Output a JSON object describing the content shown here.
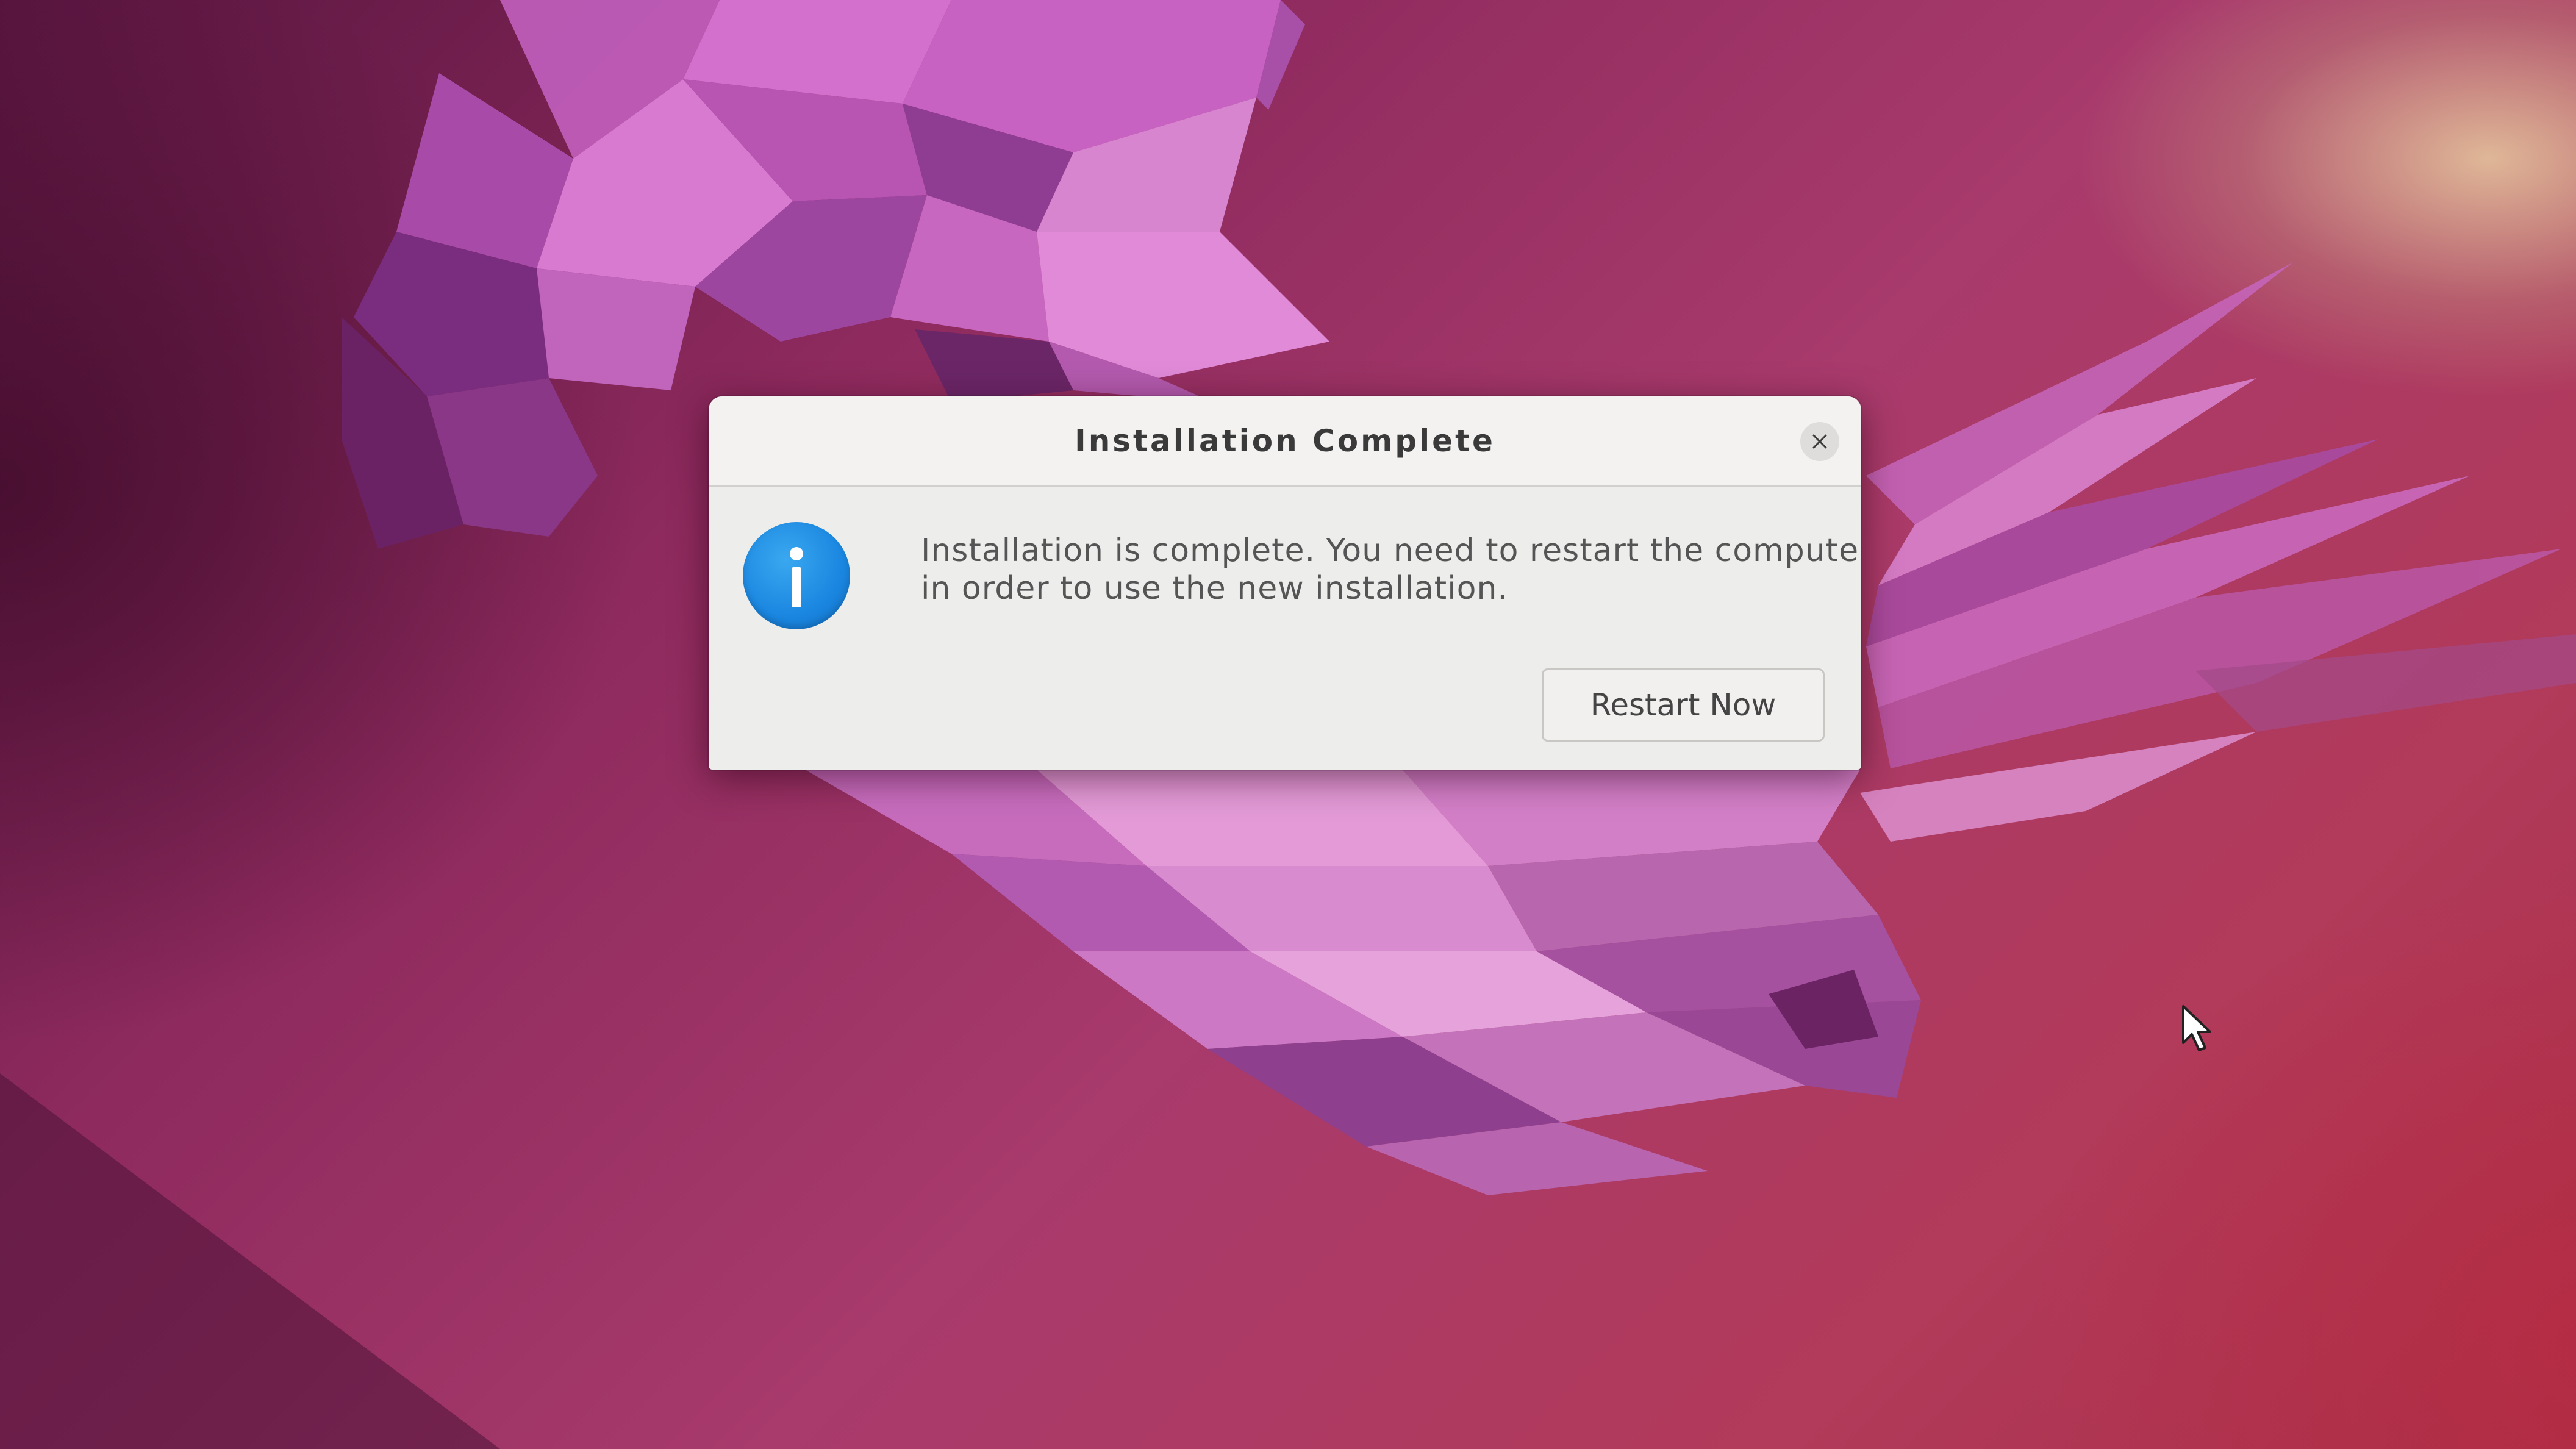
{
  "dialog": {
    "title": "Installation Complete",
    "message_line1": "Installation is complete. You need to restart the computer",
    "message_line2": "in order to use the new installation.",
    "primary_button_label": "Restart Now",
    "icon": "info-icon",
    "close_icon": "close-icon"
  },
  "desktop": {
    "wallpaper": "ubuntu-jammy-jellyfish-wallpaper",
    "pointer": "mouse-pointer-icon"
  },
  "colors": {
    "info_icon": "#1a86e0",
    "dialog_background": "#ededec",
    "wallpaper_base": "#a83a6c"
  }
}
